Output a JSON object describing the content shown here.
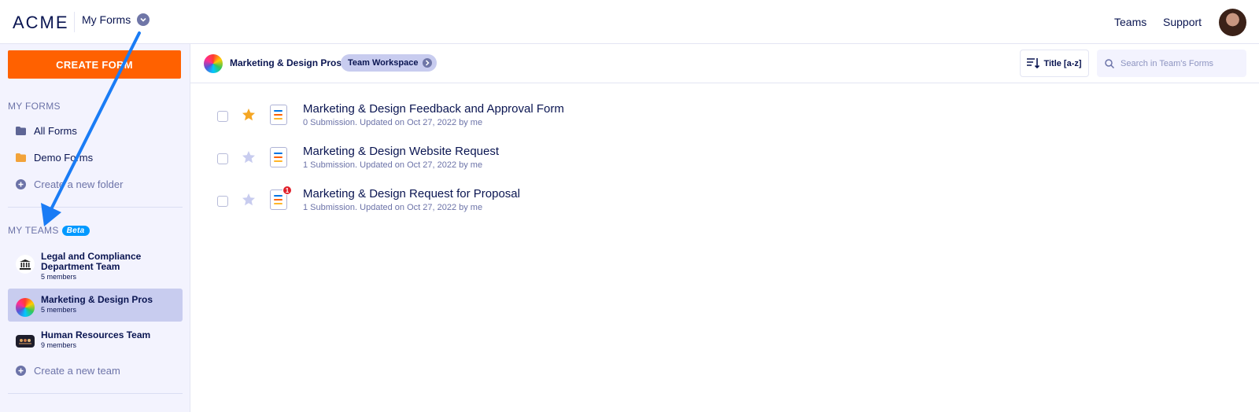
{
  "header": {
    "logo": "ACME",
    "myforms_label": "My Forms",
    "nav": [
      "Teams",
      "Support"
    ]
  },
  "sidebar": {
    "create_label": "CREATE FORM",
    "my_forms_title": "MY FORMS",
    "folders": [
      {
        "label": "All Forms",
        "icon": "folder-icon",
        "color": "#5e6595"
      },
      {
        "label": "Demo Forms",
        "icon": "folder-icon",
        "color": "#f2a33a"
      }
    ],
    "new_folder_label": "Create a new folder",
    "my_teams_title": "MY TEAMS",
    "beta_label": "Beta",
    "teams": [
      {
        "name": "Legal and Compliance Department Team",
        "members": "5 members",
        "icon": "courthouse-icon"
      },
      {
        "name": "Marketing & Design Pros",
        "members": "5 members",
        "icon": "color-wheel-icon",
        "selected": true
      },
      {
        "name": "Human Resources Team",
        "members": "9 members",
        "icon": "hr-team-icon"
      }
    ],
    "new_team_label": "Create a new team"
  },
  "workspace": {
    "name": "Marketing & Design Pros",
    "pill_label": "Team Workspace",
    "sort_label": "Title [a-z]",
    "search_placeholder": "Search in Team's Forms"
  },
  "forms": [
    {
      "title": "Marketing & Design Feedback and Approval Form",
      "meta": "0 Submission. Updated on Oct 27, 2022 by me",
      "starred": true,
      "badge": ""
    },
    {
      "title": "Marketing & Design Website Request",
      "meta": "1 Submission. Updated on Oct 27, 2022 by me",
      "starred": false,
      "badge": ""
    },
    {
      "title": "Marketing & Design Request for Proposal",
      "meta": "1 Submission. Updated on Oct 27, 2022 by me",
      "starred": false,
      "badge": "1"
    }
  ],
  "colors": {
    "accent": "#ff6100",
    "navy": "#0a1551",
    "annotation_arrow": "#1a7cf5",
    "star_active": "#f5a623",
    "star_inactive": "#c8ccef"
  }
}
